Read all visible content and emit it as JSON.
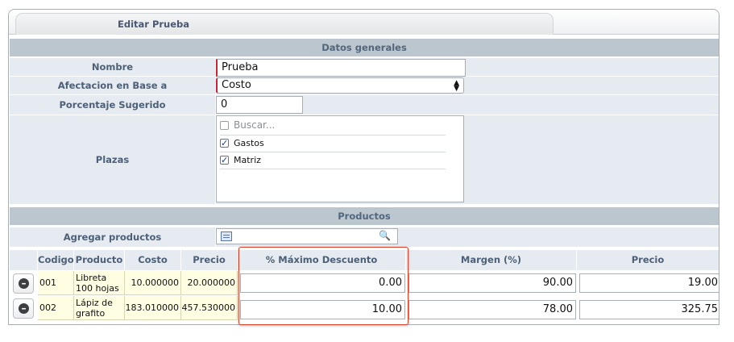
{
  "tab": {
    "title": "Editar Prueba"
  },
  "sections": {
    "general": "Datos generales",
    "products": "Productos"
  },
  "form": {
    "nombre": {
      "label": "Nombre",
      "value": "Prueba"
    },
    "afectacion": {
      "label": "Afectacion en Base a",
      "value": "Costo"
    },
    "porcentaje": {
      "label": "Porcentaje Sugerido",
      "value": "0"
    },
    "plazas": {
      "label": "Plazas",
      "search_placeholder": "Buscar...",
      "items": [
        {
          "label": "Gastos",
          "checked": true
        },
        {
          "label": "Matriz",
          "checked": true
        }
      ]
    }
  },
  "agregar": {
    "label": "Agregar productos"
  },
  "table": {
    "headers": [
      "Codigo",
      "Producto",
      "Costo",
      "Precio",
      "% Máximo Descuento",
      "Margen (%)",
      "Precio"
    ],
    "rows": [
      {
        "codigo": "001",
        "producto": "Libreta 100 hojas",
        "costo": "10.000000",
        "precio": "20.000000",
        "descuento": "0.00",
        "margen": "90.00",
        "precio_final": "19.00"
      },
      {
        "codigo": "002",
        "producto": "Lápiz de grafito",
        "costo": "183.010000",
        "precio": "457.530000",
        "descuento": "10.00",
        "margen": "78.00",
        "precio_final": "325.75"
      }
    ]
  },
  "colors": {
    "accent": "#d9412b",
    "header_bg": "#bcc6ce",
    "label_bg": "#e6ebf1",
    "cell_bg": "#fffde2"
  }
}
